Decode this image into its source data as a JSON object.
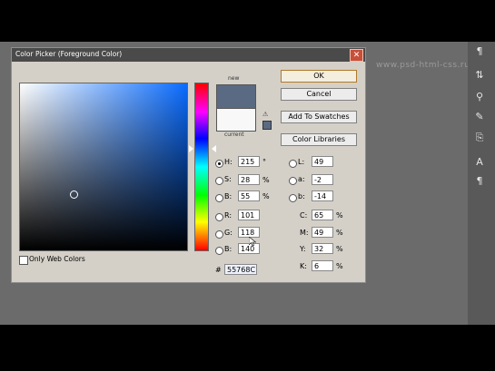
{
  "window": {
    "title": "Color Picker (Foreground Color)",
    "close_glyph": "✕"
  },
  "watermark": "www.psd-html-css.ru",
  "preview": {
    "new_label": "new",
    "current_label": "current",
    "new_color": "#5a6a82",
    "current_color": "#f8f8f8"
  },
  "buttons": {
    "ok": "OK",
    "cancel": "Cancel",
    "add_to_swatches": "Add To Swatches",
    "color_libraries": "Color Libraries"
  },
  "hsb": [
    {
      "key": "H",
      "label": "H:",
      "value": "215",
      "unit": "°",
      "selected": true
    },
    {
      "key": "S",
      "label": "S:",
      "value": "28",
      "unit": "%",
      "selected": false
    },
    {
      "key": "B",
      "label": "B:",
      "value": "55",
      "unit": "%",
      "selected": false
    }
  ],
  "rgb": [
    {
      "key": "R",
      "label": "R:",
      "value": "101"
    },
    {
      "key": "G",
      "label": "G:",
      "value": "118"
    },
    {
      "key": "B",
      "label": "B:",
      "value": "140"
    }
  ],
  "lab": [
    {
      "key": "L",
      "label": "L:",
      "value": "49"
    },
    {
      "key": "a",
      "label": "a:",
      "value": "-2"
    },
    {
      "key": "b",
      "label": "b:",
      "value": "-14"
    }
  ],
  "cmyk": [
    {
      "key": "C",
      "label": "C:",
      "value": "65",
      "unit": "%"
    },
    {
      "key": "M",
      "label": "M:",
      "value": "49",
      "unit": "%"
    },
    {
      "key": "Y",
      "label": "Y:",
      "value": "32",
      "unit": "%"
    },
    {
      "key": "K",
      "label": "K:",
      "value": "6",
      "unit": "%"
    }
  ],
  "hex": {
    "label": "#",
    "value": "55768C"
  },
  "only_web_colors": {
    "label": "Only Web Colors",
    "checked": false
  },
  "toolbar_icons": [
    "paragraph-glyph-icon",
    "character-icon",
    "clone-stamp-icon",
    "brush-icon",
    "type-icon",
    "paragraph-icon"
  ]
}
